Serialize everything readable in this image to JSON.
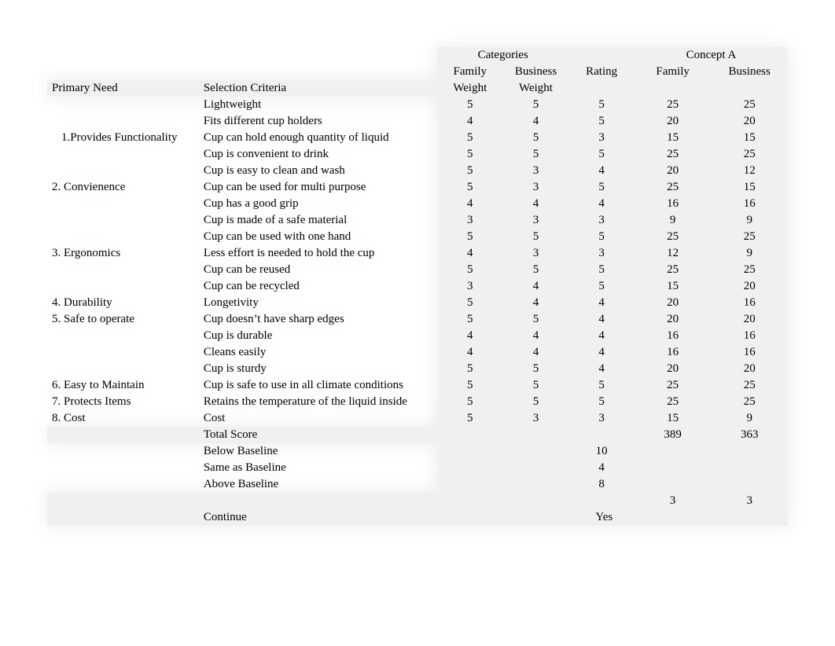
{
  "headers": {
    "categories": "Categories",
    "conceptA": "Concept A",
    "primaryNeed": "Primary Need",
    "selectionCriteria": "Selection Criteria",
    "familyWeight1": "Family",
    "familyWeight2": "Weight",
    "businessWeight1": "Business",
    "businessWeight2": "Weight",
    "rating": "Rating",
    "family": "Family",
    "business": "Business"
  },
  "rows": [
    {
      "need": "",
      "crit": "Lightweight",
      "fw": 5,
      "bw": 5,
      "r": 5,
      "f": 25,
      "b": 25
    },
    {
      "need": "",
      "crit": "Fits different cup holders",
      "fw": 4,
      "bw": 4,
      "r": 5,
      "f": 20,
      "b": 20
    },
    {
      "need": "1.Provides Functionality",
      "crit": "Cup can hold enough quantity of liquid",
      "fw": 5,
      "bw": 5,
      "r": 3,
      "f": 15,
      "b": 15,
      "indent": true
    },
    {
      "need": "",
      "crit": "Cup is convenient to drink",
      "fw": 5,
      "bw": 5,
      "r": 5,
      "f": 25,
      "b": 25
    },
    {
      "need": "",
      "crit": "Cup is easy to clean and wash",
      "fw": 5,
      "bw": 3,
      "r": 4,
      "f": 20,
      "b": 12
    },
    {
      "need": "2. Convienence",
      "crit": "Cup can be used for multi purpose",
      "fw": 5,
      "bw": 3,
      "r": 5,
      "f": 25,
      "b": 15
    },
    {
      "need": "",
      "crit": "Cup has a good grip",
      "fw": 4,
      "bw": 4,
      "r": 4,
      "f": 16,
      "b": 16
    },
    {
      "need": "",
      "crit": "Cup is made of a safe material",
      "fw": 3,
      "bw": 3,
      "r": 3,
      "f": 9,
      "b": 9
    },
    {
      "need": "",
      "crit": "Cup can be used with one hand",
      "fw": 5,
      "bw": 5,
      "r": 5,
      "f": 25,
      "b": 25
    },
    {
      "need": "3. Ergonomics",
      "crit": "Less effort is needed to hold the cup",
      "fw": 4,
      "bw": 3,
      "r": 3,
      "f": 12,
      "b": 9
    },
    {
      "need": "",
      "crit": "Cup can be reused",
      "fw": 5,
      "bw": 5,
      "r": 5,
      "f": 25,
      "b": 25
    },
    {
      "need": "",
      "crit": "Cup can be recycled",
      "fw": 3,
      "bw": 4,
      "r": 5,
      "f": 15,
      "b": 20
    },
    {
      "need": "4. Durability",
      "crit": "Longetivity",
      "fw": 5,
      "bw": 4,
      "r": 4,
      "f": 20,
      "b": 16
    },
    {
      "need": "5. Safe to operate",
      "crit": "Cup doesn’t have sharp edges",
      "fw": 5,
      "bw": 5,
      "r": 4,
      "f": 20,
      "b": 20
    },
    {
      "need": "",
      "crit": "Cup is durable",
      "fw": 4,
      "bw": 4,
      "r": 4,
      "f": 16,
      "b": 16
    },
    {
      "need": "",
      "crit": "Cleans easily",
      "fw": 4,
      "bw": 4,
      "r": 4,
      "f": 16,
      "b": 16
    },
    {
      "need": "",
      "crit": "Cup is sturdy",
      "fw": 5,
      "bw": 5,
      "r": 4,
      "f": 20,
      "b": 20
    },
    {
      "need": "6. Easy to Maintain",
      "crit": "Cup is safe to use in all climate conditions",
      "fw": 5,
      "bw": 5,
      "r": 5,
      "f": 25,
      "b": 25
    },
    {
      "need": "7. Protects Items",
      "crit": "Retains the temperature of the liquid inside",
      "fw": 5,
      "bw": 5,
      "r": 5,
      "f": 25,
      "b": 25
    },
    {
      "need": "8. Cost",
      "crit": "Cost",
      "fw": 5,
      "bw": 3,
      "r": 3,
      "f": 15,
      "b": 9
    }
  ],
  "footer": {
    "totalScoreLabel": "Total Score",
    "totalFamily": 389,
    "totalBusiness": 363,
    "belowBaselineLabel": "Below Baseline",
    "belowBaseline": 10,
    "sameBaselineLabel": "Same as Baseline",
    "sameBaseline": 4,
    "aboveBaselineLabel": "Above Baseline",
    "aboveBaseline": 8,
    "rankFamily": 3,
    "rankBusiness": 3,
    "continueLabel": "Continue",
    "continueValue": "Yes"
  }
}
